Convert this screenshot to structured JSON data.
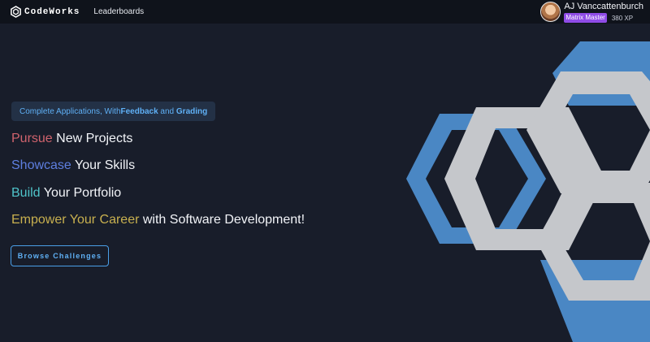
{
  "brand": {
    "name": "CodeWorks",
    "logo_icon": "hexagon-logo-icon"
  },
  "nav": {
    "leaderboards_label": "Leaderboards"
  },
  "user": {
    "name": "AJ Vanccattenburch",
    "rank": "Matrix Master",
    "xp": "380 XP",
    "rank_color": "#8f4ce6"
  },
  "hero": {
    "tagline": {
      "prefix": "Complete Applications, With ",
      "feedback": "Feedback",
      "middle": " and ",
      "grading": "Grading"
    },
    "lines": [
      {
        "accent": "Pursue",
        "rest": " New Projects"
      },
      {
        "accent": "Showcase",
        "rest": " Your Skills"
      },
      {
        "accent": "Build",
        "rest": " Your Portfolio"
      },
      {
        "accent": "Empower Your Career",
        "rest": " with Software Development!"
      }
    ],
    "cta_label": "Browse Challenges",
    "graphic_icon": "interlocking-hexagons-graphic"
  },
  "colors": {
    "background": "#181d2a",
    "navbar": "#0f131b",
    "accent_blue": "#4a87c4",
    "hex_gray": "#c5c7cb",
    "pursue": "#d0636d",
    "showcase": "#5e7fe0",
    "build": "#4fc3c9",
    "empower": "#c8b04f"
  }
}
